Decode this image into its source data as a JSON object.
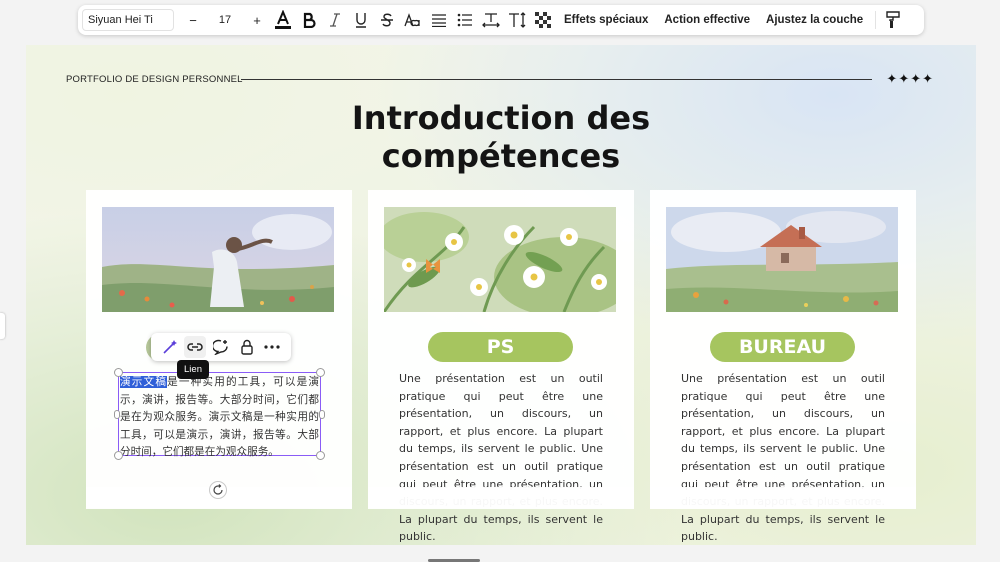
{
  "toolbar": {
    "font_family": "Siyuan Hei Ti",
    "decrease": "−",
    "font_size": "17",
    "increase": "+",
    "special_effects": "Effets spéciaux",
    "effective_action": "Action effective",
    "adjust_layer": "Ajustez la couche"
  },
  "slide": {
    "header": "PORTFOLIO DE DESIGN PERSONNEL",
    "stars": "✦✦✦✦",
    "title_line1": "Introduction des",
    "title_line2": "compétences"
  },
  "cards": [
    {
      "text_highlight": "演示文稿",
      "text_rest": "是一种实用的工具，可以是演示，演讲，报告等。大部分时间，它们都是在为观众服务。演示文稿是一种实用的工具，可以是演示，演讲，报告等。大部分时间，它们都是在为观众服务。"
    },
    {
      "badge": "PS",
      "text": "Une présentation est un outil pratique qui peut être une présentation, un discours, un rapport, et plus encore. La plupart du temps, ils servent le public. Une présentation est un outil pratique qui peut être une présentation, un discours, un rapport, et plus encore. La plupart du temps, ils servent le public."
    },
    {
      "badge": "BUREAU",
      "text": "Une présentation est un outil pratique qui peut être une présentation, un discours, un rapport, et plus encore. La plupart du temps, ils servent le public. Une présentation est un outil pratique qui peut être une présentation, un discours, un rapport, et plus encore. La plupart du temps, ils servent le public."
    }
  ],
  "edit_overlay": {
    "tooltip": "Lien"
  },
  "colors": {
    "badge": "#a6c55f",
    "selection": "#8a5cf6",
    "highlight": "#2f5fd8"
  }
}
